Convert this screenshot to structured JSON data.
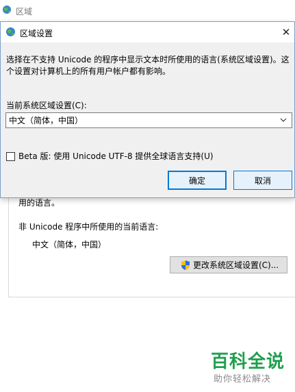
{
  "background": {
    "window_title": "区域",
    "partial_text": "用的语言。",
    "non_unicode_label": "非 Unicode 程序中所使用的当前语言:",
    "current_language": "中文（简体，中国）",
    "change_button_label": "更改系统区域设置(C)..."
  },
  "dialog": {
    "title": "区域设置",
    "close_glyph": "✕",
    "description": "选择在不支持 Unicode 的程序中显示文本时所使用的语言(系统区域设置)。这个设置对计算机上的所有用户帐户都有影响。",
    "locale_label": "当前系统区域设置(C):",
    "locale_value": "中文（简体，中国）",
    "beta_checked": false,
    "beta_label": "Beta 版: 使用 Unicode UTF-8 提供全球语言支持(U)",
    "ok_label": "确定",
    "cancel_label": "取消"
  },
  "watermark": {
    "title": "百科全说",
    "subtitle": "助你轻松解决"
  },
  "colors": {
    "accent": "#0078d7",
    "dialog_bg": "#f0f0f0",
    "watermark_green": "#1e9f4c"
  }
}
